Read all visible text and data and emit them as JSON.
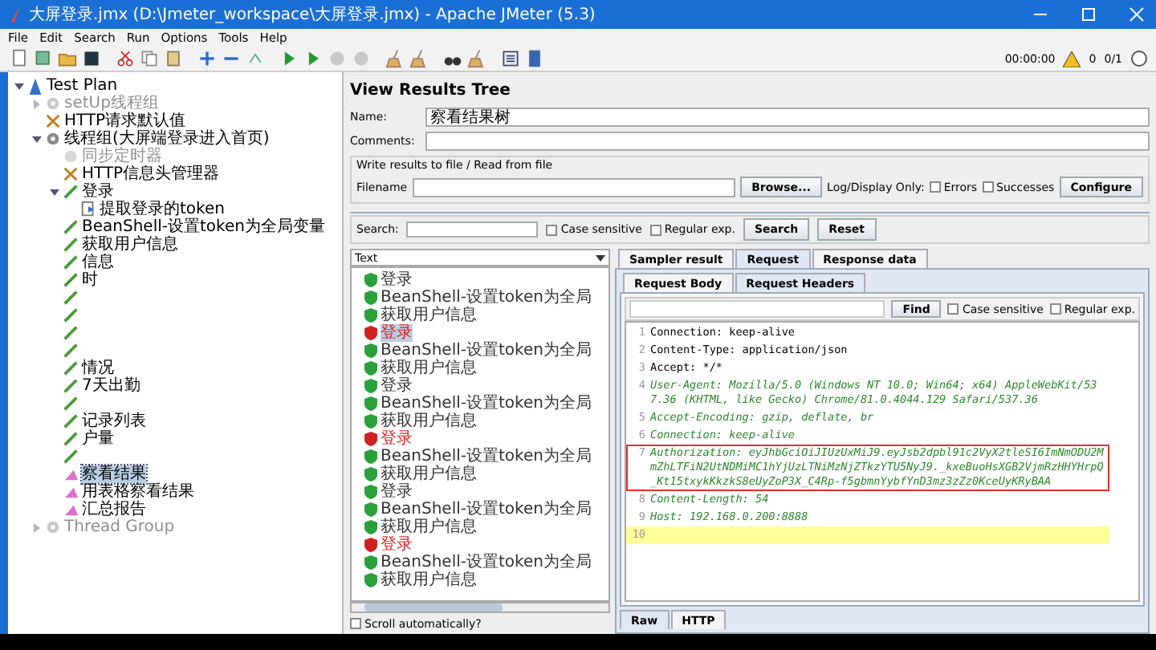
{
  "window": {
    "title": "大屏登录.jmx (D:\\Jmeter_workspace\\大屏登录.jmx) - Apache JMeter (5.3)"
  },
  "menu": [
    "File",
    "Edit",
    "Search",
    "Run",
    "Options",
    "Tools",
    "Help"
  ],
  "toolbar": {
    "timer": "00:00:00",
    "warnings": "0",
    "threads": "0/1"
  },
  "tree": [
    {
      "label": "Test Plan",
      "kind": "plan",
      "expanded": true,
      "disabled": false,
      "selected": false,
      "children": [
        {
          "label": "setUp线程组",
          "kind": "thread",
          "expanded": false,
          "disabled": true,
          "selected": false
        },
        {
          "label": "HTTP请求默认值",
          "kind": "config",
          "disabled": false,
          "selected": false
        },
        {
          "label": "线程组(大屏端登录进入首页)",
          "kind": "thread",
          "expanded": true,
          "disabled": false,
          "selected": false,
          "children": [
            {
              "label": "同步定时器",
              "kind": "timer",
              "disabled": true,
              "selected": false
            },
            {
              "label": "HTTP信息头管理器",
              "kind": "config",
              "disabled": false,
              "selected": false
            },
            {
              "label": "登录",
              "kind": "sampler",
              "expanded": true,
              "disabled": false,
              "selected": false,
              "children": [
                {
                  "label": "提取登录的token",
                  "kind": "extractor",
                  "disabled": false,
                  "selected": false
                }
              ]
            },
            {
              "label": "BeanShell-设置token为全局变量",
              "kind": "sampler",
              "disabled": false,
              "selected": false
            },
            {
              "label": "获取用户信息",
              "kind": "sampler",
              "disabled": false,
              "selected": false
            },
            {
              "label": "信息",
              "kind": "sampler",
              "disabled": false,
              "selected": false
            },
            {
              "label": "时",
              "kind": "sampler",
              "disabled": false,
              "selected": false
            },
            {
              "kind": "sampler",
              "disabled": false,
              "selected": false
            },
            {
              "kind": "sampler",
              "disabled": false,
              "selected": false
            },
            {
              "kind": "sampler",
              "disabled": false,
              "selected": false
            },
            {
              "kind": "sampler",
              "disabled": false,
              "selected": false
            },
            {
              "label": "情况",
              "kind": "sampler",
              "disabled": false,
              "selected": false
            },
            {
              "label": "7天出勤",
              "kind": "sampler",
              "disabled": false,
              "selected": false
            },
            {
              "kind": "sampler",
              "disabled": false,
              "selected": false
            },
            {
              "label": "记录列表",
              "kind": "sampler",
              "disabled": false,
              "selected": false
            },
            {
              "label": "户量",
              "kind": "sampler",
              "disabled": false,
              "selected": false
            },
            {
              "kind": "sampler",
              "disabled": false,
              "selected": false
            },
            {
              "label": "察看结果",
              "kind": "listener",
              "disabled": false,
              "selected": true
            },
            {
              "label": "用表格察看结果",
              "kind": "listener",
              "disabled": false,
              "selected": false
            },
            {
              "label": "汇总报告",
              "kind": "listener",
              "disabled": false,
              "selected": false
            }
          ]
        },
        {
          "label": "Thread Group",
          "kind": "thread",
          "expanded": false,
          "disabled": true,
          "selected": false
        }
      ]
    }
  ],
  "panel": {
    "title": "View Results Tree",
    "name_label": "Name:",
    "name_value": "察看结果树",
    "comments_label": "Comments:",
    "file_section": "Write results to file / Read from file",
    "filename_label": "Filename",
    "browse": "Browse...",
    "log_label": "Log/Display Only:",
    "errors": {
      "label": "Errors",
      "checked": false
    },
    "successes": {
      "label": "Successes",
      "checked": false
    },
    "configure": "Configure"
  },
  "search": {
    "label": "Search:",
    "case": {
      "label": "Case sensitive",
      "checked": false
    },
    "regex": {
      "label": "Regular exp.",
      "checked": false
    },
    "search_button": "Search",
    "reset_button": "Reset"
  },
  "results": {
    "renderer": "Text",
    "items": [
      {
        "label": "登录",
        "success": true,
        "selected": false
      },
      {
        "label": "BeanShell-设置token为全局",
        "success": true,
        "selected": false
      },
      {
        "label": "获取用户信息",
        "success": true,
        "selected": false
      },
      {
        "label": "登录",
        "success": false,
        "selected": true
      },
      {
        "label": "BeanShell-设置token为全局",
        "success": true,
        "selected": false
      },
      {
        "label": "获取用户信息",
        "success": true,
        "selected": false
      },
      {
        "label": "登录",
        "success": true,
        "selected": false
      },
      {
        "label": "BeanShell-设置token为全局",
        "success": true,
        "selected": false
      },
      {
        "label": "获取用户信息",
        "success": true,
        "selected": false
      },
      {
        "label": "登录",
        "success": false,
        "selected": false
      },
      {
        "label": "BeanShell-设置token为全局",
        "success": true,
        "selected": false
      },
      {
        "label": "获取用户信息",
        "success": true,
        "selected": false
      },
      {
        "label": "登录",
        "success": true,
        "selected": false
      },
      {
        "label": "BeanShell-设置token为全局",
        "success": true,
        "selected": false
      },
      {
        "label": "获取用户信息",
        "success": true,
        "selected": false
      },
      {
        "label": "登录",
        "success": false,
        "selected": false
      },
      {
        "label": "BeanShell-设置token为全局",
        "success": true,
        "selected": false
      },
      {
        "label": "获取用户信息",
        "success": true,
        "selected": false
      }
    ],
    "scroll_auto": {
      "label": "Scroll automatically?",
      "checked": false
    }
  },
  "tabs": [
    {
      "label": "Sampler result",
      "selected": false
    },
    {
      "label": "Request",
      "selected": true
    },
    {
      "label": "Response data",
      "selected": false
    }
  ],
  "subtabs": [
    {
      "label": "Request Body",
      "selected": false
    },
    {
      "label": "Request Headers",
      "selected": true
    }
  ],
  "find": {
    "button": "Find",
    "case": {
      "label": "Case sensitive",
      "checked": false
    },
    "regex": {
      "label": "Regular exp.",
      "checked": false
    }
  },
  "headers": [
    {
      "number": "1",
      "text": "Connection: keep-alive",
      "kind": "plain"
    },
    {
      "number": "2",
      "text": "Content-Type: application/json",
      "kind": "plain"
    },
    {
      "number": "3",
      "text": "Accept: */*",
      "kind": "plain"
    },
    {
      "number": "4",
      "text": "User-Agent: Mozilla/5.0 (Windows NT 10.0; Win64; x64) AppleWebKit/537.36 (KHTML, like Gecko) Chrome/81.0.4044.129 Safari/537.36",
      "kind": "italic"
    },
    {
      "number": "5",
      "text": "Accept-Encoding: gzip, deflate, br",
      "kind": "italic"
    },
    {
      "number": "6",
      "text": "Connection: keep-alive",
      "kind": "italic"
    },
    {
      "number": "7",
      "text": "Authorization: eyJhbGciOiJIUzUxMiJ9.eyJsb2dpbl91c2VyX2tleSI6ImNmODU2MmZhLTFiN2UtNDMiMC1hYjUzLTNiMzNjZTkzYTU5NyJ9._kxeBuoHsXGB2VjmRzHHYHrpQ_Kt15txykKkzkS8eUyZoP3X_C4Rp-f5gbmnYybfYnD3mz3zZz0KceUyKRyBAA",
      "kind": "boxed"
    },
    {
      "number": "8",
      "text": "Content-Length: 54",
      "kind": "italic"
    },
    {
      "number": "9",
      "text": "Host: 192.168.0.200:8888",
      "kind": "italic"
    },
    {
      "number": "10",
      "kind": "cursor"
    }
  ],
  "bottom_tabs": [
    {
      "label": "Raw",
      "selected": true
    },
    {
      "label": "HTTP",
      "selected": false
    }
  ]
}
